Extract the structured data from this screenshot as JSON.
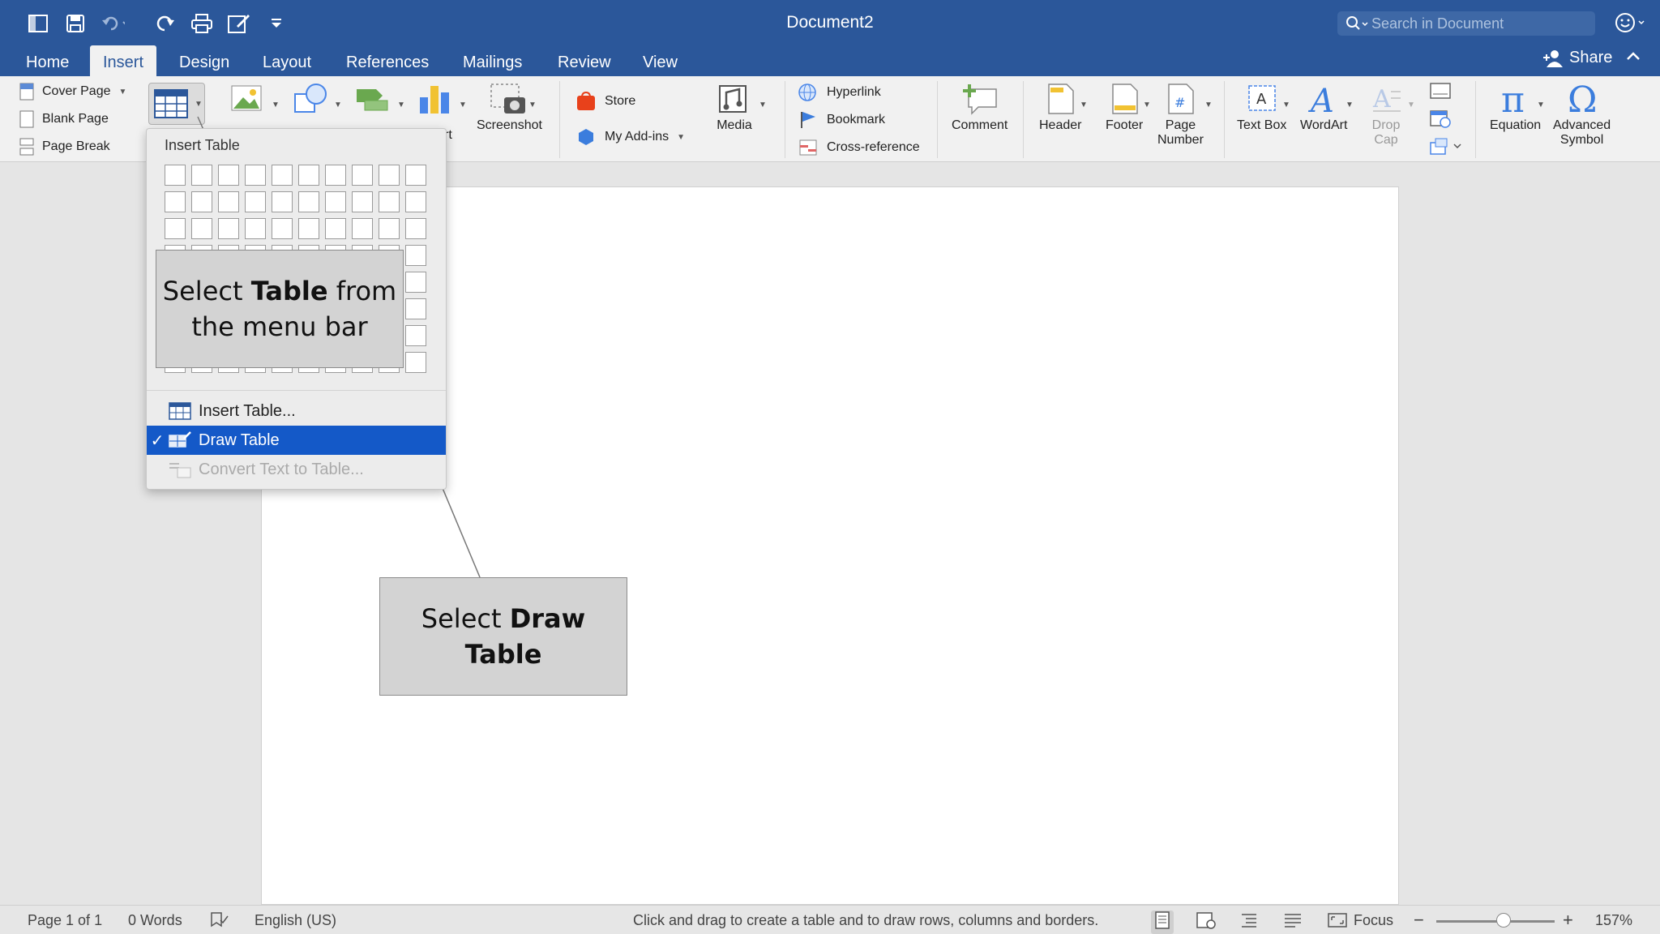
{
  "title_bar": {
    "document_title": "Document2",
    "search_placeholder": "Search in Document",
    "quick_access": [
      "sidebar-toggle-icon",
      "save-icon",
      "undo-icon",
      "redo-icon",
      "print-icon",
      "edit-icon",
      "customize-icon"
    ]
  },
  "tabs": [
    {
      "label": "Home",
      "active": false
    },
    {
      "label": "Insert",
      "active": true
    },
    {
      "label": "Design",
      "active": false
    },
    {
      "label": "Layout",
      "active": false
    },
    {
      "label": "References",
      "active": false
    },
    {
      "label": "Mailings",
      "active": false
    },
    {
      "label": "Review",
      "active": false
    },
    {
      "label": "View",
      "active": false
    }
  ],
  "share_label": "Share",
  "ribbon": {
    "pages": {
      "cover_page": "Cover Page",
      "blank_page": "Blank Page",
      "page_break": "Page Break"
    },
    "partial_label": "rt",
    "screenshot": "Screenshot",
    "store": "Store",
    "my_addins": "My Add-ins",
    "media": "Media",
    "links": {
      "hyperlink": "Hyperlink",
      "bookmark": "Bookmark",
      "cross_reference": "Cross-reference"
    },
    "comment": "Comment",
    "header": "Header",
    "footer": "Footer",
    "page_number": [
      "Page",
      "Number"
    ],
    "text_box": "Text Box",
    "wordart": "WordArt",
    "drop_cap": [
      "Drop",
      "Cap"
    ],
    "equation": "Equation",
    "advanced_symbol": [
      "Advanced",
      "Symbol"
    ]
  },
  "table_dropdown": {
    "title": "Insert Table",
    "items": {
      "insert_table": "Insert Table...",
      "draw_table": "Draw Table",
      "convert_text": "Convert Text to Table..."
    },
    "checkmark": "✓"
  },
  "callouts": {
    "table": {
      "pre": "Select ",
      "bold": "Table",
      "post": " from the menu bar"
    },
    "draw": {
      "pre": "Select ",
      "bold": "Draw Table",
      "post": ""
    }
  },
  "status_bar": {
    "page": "Page 1 of 1",
    "words": "0 Words",
    "language": "English (US)",
    "hint": "Click and drag to create a table and to draw rows, columns and borders.",
    "focus": "Focus",
    "zoom_minus": "−",
    "zoom_plus": "+",
    "zoom": "157%",
    "zoom_fraction": 0.5
  },
  "colors": {
    "title_bar": "#2b579a",
    "highlight": "#1459c8",
    "ribbon": "#f1f1f1",
    "canvas": "#e5e5e5"
  }
}
